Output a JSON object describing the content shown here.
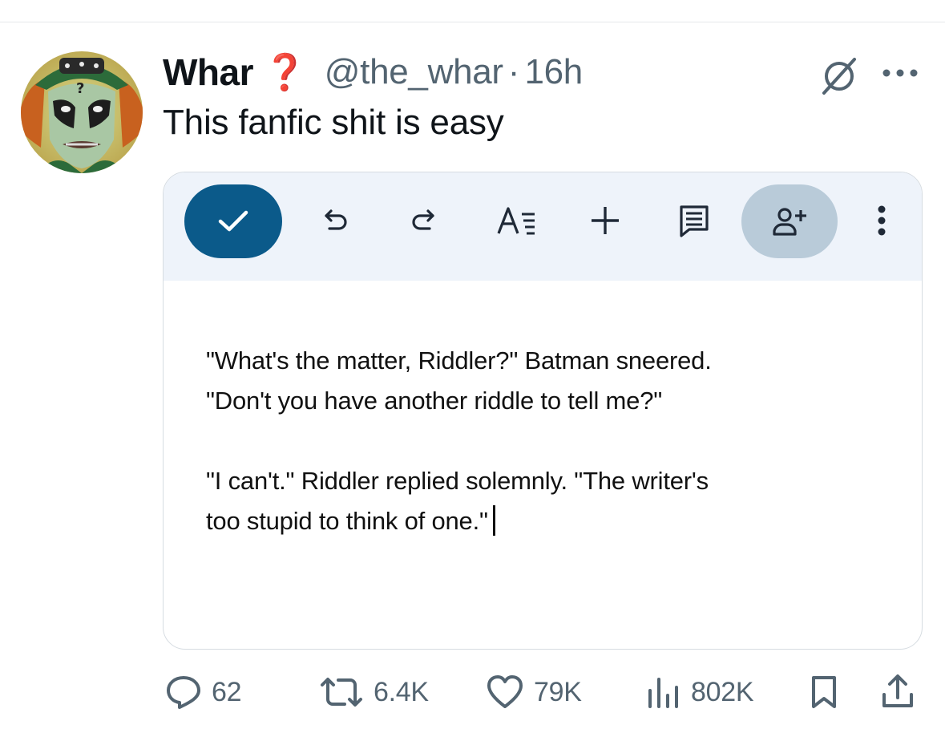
{
  "tweet": {
    "author_name": "Whar",
    "name_emoji": "❓",
    "handle": "@the_whar",
    "separator": "·",
    "time": "16h",
    "text": "This fanfic shit is easy",
    "header_icons": [
      "grok-icon",
      "more-icon"
    ]
  },
  "editor": {
    "toolbar_icons": [
      "checkmark-icon",
      "undo-icon",
      "redo-icon",
      "text-format-icon",
      "insert-icon",
      "comment-icon",
      "add-person-icon",
      "more-vertical-icon"
    ],
    "paragraphs": [
      [
        "\"What's the matter, Riddler?\" Batman sneered.",
        "\"Don't you have another riddle to tell me?\""
      ],
      [
        "\"I can't.\" Riddler replied solemnly. \"The writer's",
        "too stupid to think of one.\""
      ]
    ]
  },
  "actions": {
    "replies": "62",
    "reposts": "6.4K",
    "likes": "79K",
    "views": "802K"
  },
  "colors": {
    "accent": "#0b5a8a",
    "share_pill": "#b9cbd9",
    "toolbar_bg": "#eef3fa",
    "muted_text": "#536471",
    "emoji_red": "#e0245e"
  }
}
